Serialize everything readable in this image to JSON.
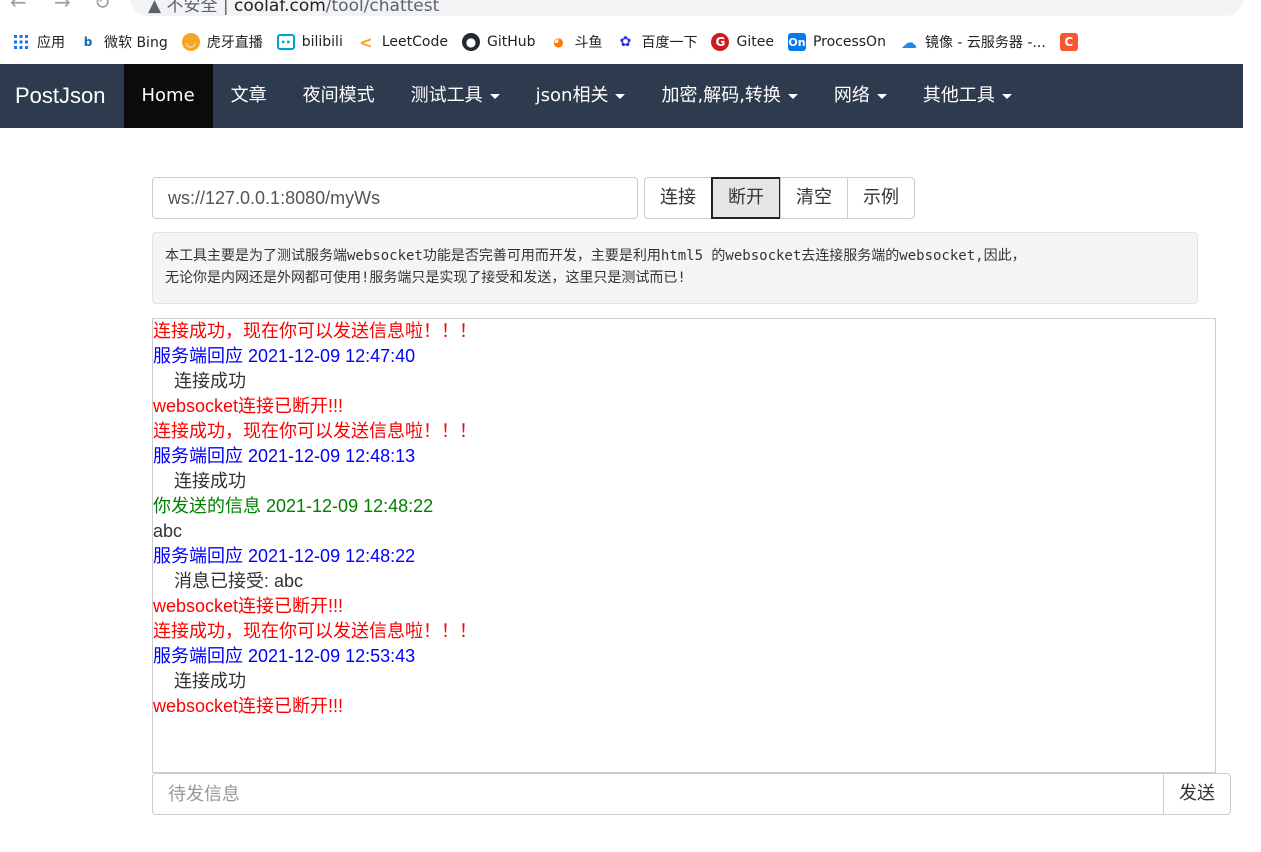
{
  "browser": {
    "security_label": "不安全",
    "separator": "|",
    "url_host": "coolaf.com",
    "url_path": "/tool/chattest"
  },
  "bookmarks": [
    {
      "label": "应用",
      "icon": "apps-grid-icon",
      "color": "#1a73e8"
    },
    {
      "label": "微软 Bing",
      "icon": "bing-icon",
      "color": "#0f6cbd"
    },
    {
      "label": "虎牙直播",
      "icon": "huya-icon",
      "color": "#f5a623"
    },
    {
      "label": "bilibili",
      "icon": "bilibili-icon",
      "color": "#00a1d6"
    },
    {
      "label": "LeetCode",
      "icon": "leetcode-icon",
      "color": "#f89f1b"
    },
    {
      "label": "GitHub",
      "icon": "github-icon",
      "color": "#24292e"
    },
    {
      "label": "斗鱼",
      "icon": "douyu-icon",
      "color": "#ff7700"
    },
    {
      "label": "百度一下",
      "icon": "baidu-icon",
      "color": "#2932e1"
    },
    {
      "label": "Gitee",
      "icon": "gitee-icon",
      "color": "#c71d23"
    },
    {
      "label": "ProcessOn",
      "icon": "processon-icon",
      "color": "#067bef"
    },
    {
      "label": "镜像 - 云服务器 -...",
      "icon": "cloud-icon",
      "color": "#1e88e5"
    }
  ],
  "navbar": {
    "brand": "PostJson",
    "items": [
      {
        "label": "Home",
        "active": true,
        "dropdown": false
      },
      {
        "label": "文章",
        "active": false,
        "dropdown": false
      },
      {
        "label": "夜间模式",
        "active": false,
        "dropdown": false
      },
      {
        "label": "测试工具",
        "active": false,
        "dropdown": true
      },
      {
        "label": "json相关",
        "active": false,
        "dropdown": true
      },
      {
        "label": "加密,解码,转换",
        "active": false,
        "dropdown": true
      },
      {
        "label": "网络",
        "active": false,
        "dropdown": true
      },
      {
        "label": "其他工具",
        "active": false,
        "dropdown": true
      }
    ]
  },
  "connection": {
    "url_value": "ws://127.0.0.1:8080/myWs",
    "connect_label": "连接",
    "disconnect_label": "断开",
    "clear_label": "清空",
    "example_label": "示例"
  },
  "info": {
    "line1": "本工具主要是为了测试服务端websocket功能是否完善可用而开发，主要是利用html5 的websocket去连接服务端的websocket,因此，",
    "line2": "无论你是内网还是外网都可使用!服务端只是实现了接受和发送，这里只是测试而已!"
  },
  "log": [
    {
      "text": "连接成功，现在你可以发送信息啦！！！",
      "color": "#ff0000",
      "indent": false
    },
    {
      "text": "服务端回应 2021-12-09 12:47:40",
      "color": "#0000ff",
      "indent": false
    },
    {
      "text": "连接成功",
      "color": "#333333",
      "indent": true
    },
    {
      "text": "websocket连接已断开!!!",
      "color": "#ff0000",
      "indent": false
    },
    {
      "text": "连接成功，现在你可以发送信息啦！！！",
      "color": "#ff0000",
      "indent": false
    },
    {
      "text": "服务端回应 2021-12-09 12:48:13",
      "color": "#0000ff",
      "indent": false
    },
    {
      "text": "连接成功",
      "color": "#333333",
      "indent": true
    },
    {
      "text": "你发送的信息 2021-12-09 12:48:22",
      "color": "#008000",
      "indent": false
    },
    {
      "text": "abc",
      "color": "#333333",
      "indent": false
    },
    {
      "text": "服务端回应 2021-12-09 12:48:22",
      "color": "#0000ff",
      "indent": false
    },
    {
      "text": "消息已接受: abc",
      "color": "#333333",
      "indent": true
    },
    {
      "text": "websocket连接已断开!!!",
      "color": "#ff0000",
      "indent": false
    },
    {
      "text": "连接成功，现在你可以发送信息啦！！！",
      "color": "#ff0000",
      "indent": false
    },
    {
      "text": "服务端回应 2021-12-09 12:53:43",
      "color": "#0000ff",
      "indent": false
    },
    {
      "text": "连接成功",
      "color": "#333333",
      "indent": true
    },
    {
      "text": "websocket连接已断开!!!",
      "color": "#ff0000",
      "indent": false
    }
  ],
  "send": {
    "placeholder": "待发信息",
    "button_label": "发送"
  }
}
